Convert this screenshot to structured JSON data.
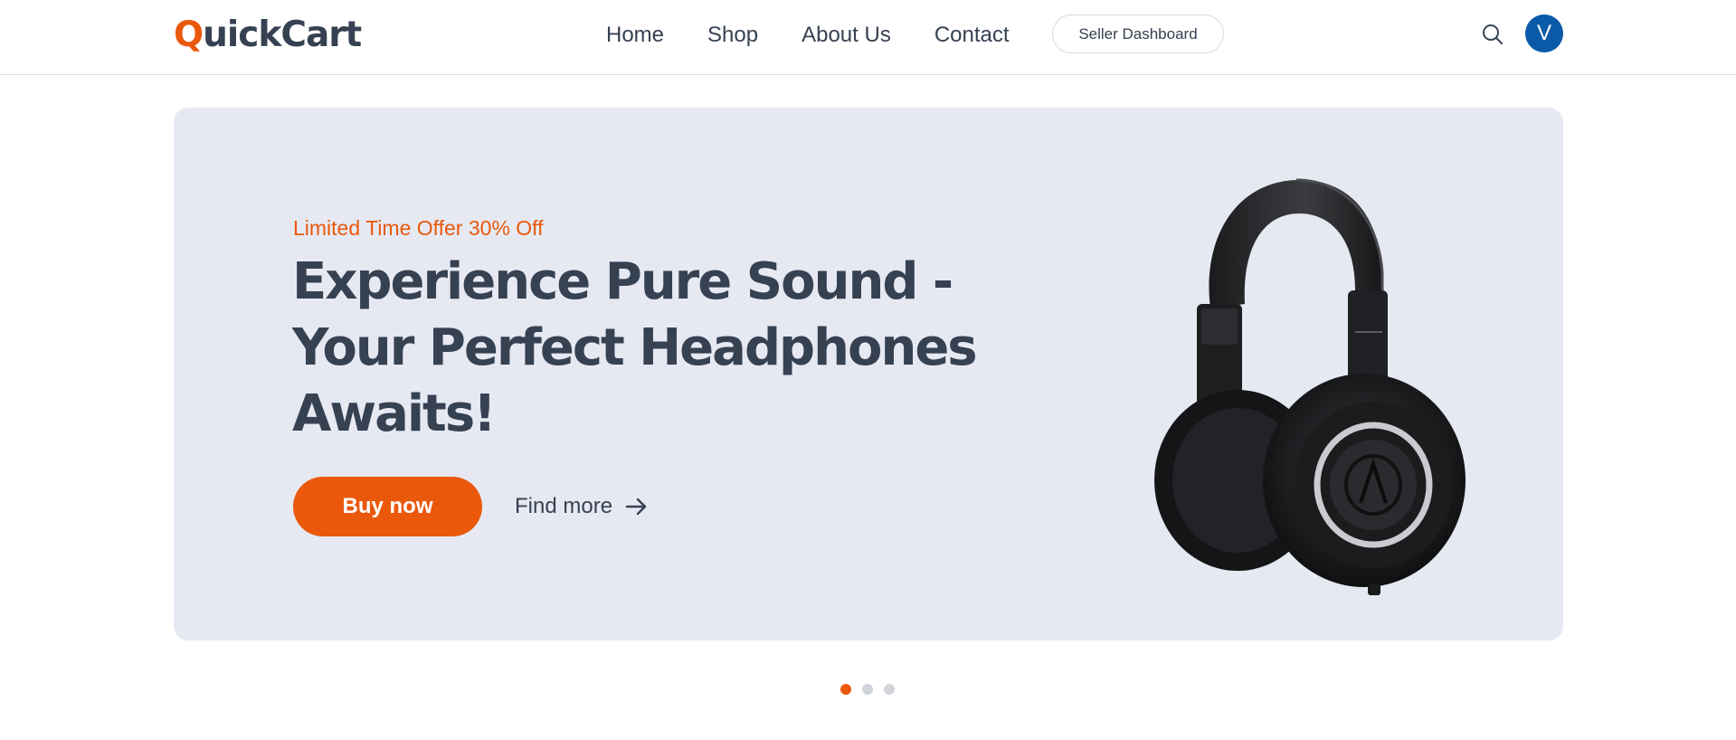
{
  "header": {
    "logo_initial": "Q",
    "logo_rest": "uickCart",
    "nav": [
      "Home",
      "Shop",
      "About Us",
      "Contact"
    ],
    "seller_dashboard": "Seller Dashboard",
    "search_icon": "search-icon",
    "avatar_initial": "V"
  },
  "hero": {
    "offer": "Limited Time Offer 30% Off",
    "headline": "Experience Pure Sound - Your Perfect Headphones Awaits!",
    "buy_label": "Buy now",
    "find_more_label": "Find more",
    "find_more_icon": "arrow-right-icon",
    "image_icon": "headphones-image"
  },
  "carousel": {
    "slide_count": 3,
    "active_index": 0
  },
  "colors": {
    "accent": "#ea580c",
    "text": "#364152",
    "hero_bg": "#e6e9f2",
    "avatar_bg": "#0a5aa8"
  }
}
